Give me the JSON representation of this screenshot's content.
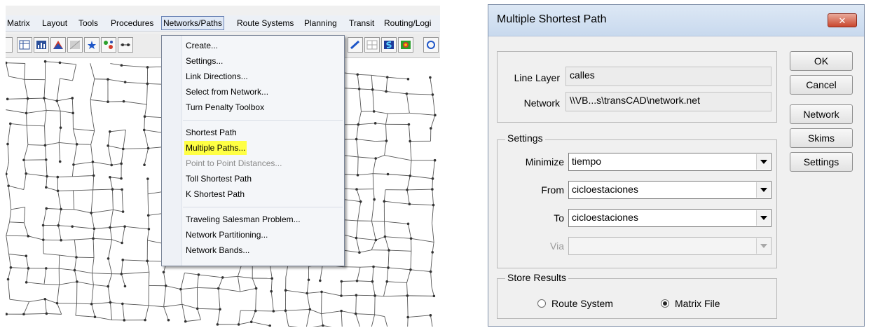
{
  "menubar": {
    "items": [
      "Matrix",
      "Layout",
      "Tools",
      "Procedures",
      "Networks/Paths",
      "Route Systems",
      "Planning",
      "Transit",
      "Routing/Logi"
    ]
  },
  "dropdown": {
    "items": [
      {
        "label": "Create..."
      },
      {
        "label": "Settings..."
      },
      {
        "label": "Link Directions..."
      },
      {
        "label": "Select from Network..."
      },
      {
        "label": "Turn Penalty Toolbox"
      },
      {
        "label": "Shortest Path"
      },
      {
        "label": "Multiple Paths..."
      },
      {
        "label": "Point to Point Distances..."
      },
      {
        "label": "Toll Shortest Path"
      },
      {
        "label": "K Shortest Path"
      },
      {
        "label": "Traveling Salesman Problem..."
      },
      {
        "label": "Network Partitioning..."
      },
      {
        "label": "Network Bands..."
      }
    ],
    "highlight_color": "#ffff44"
  },
  "dialog": {
    "title": "Multiple Shortest Path",
    "close_glyph": "✕",
    "line_layer_label": "Line Layer",
    "line_layer_value": "calles",
    "network_label": "Network",
    "network_value": "\\\\VB...s\\transCAD\\network.net",
    "settings_group": "Settings",
    "minimize_label": "Minimize",
    "minimize_value": "tiempo",
    "from_label": "From",
    "from_value": "cicloestaciones",
    "to_label": "To",
    "to_value": "cicloestaciones",
    "via_label": "Via",
    "via_value": "",
    "store_group": "Store Results",
    "route_system_label": "Route System",
    "matrix_file_label": "Matrix File",
    "selected_store": "Matrix File",
    "buttons": {
      "ok": "OK",
      "cancel": "Cancel",
      "network": "Network",
      "skims": "Skims",
      "settings": "Settings"
    }
  },
  "colors": {
    "menu_bg": "#ecf0f6",
    "dialog_bg": "#f0f0f0",
    "close_button": "#c9472e",
    "map_lines": "#555555",
    "map_nodes": "#333333"
  }
}
